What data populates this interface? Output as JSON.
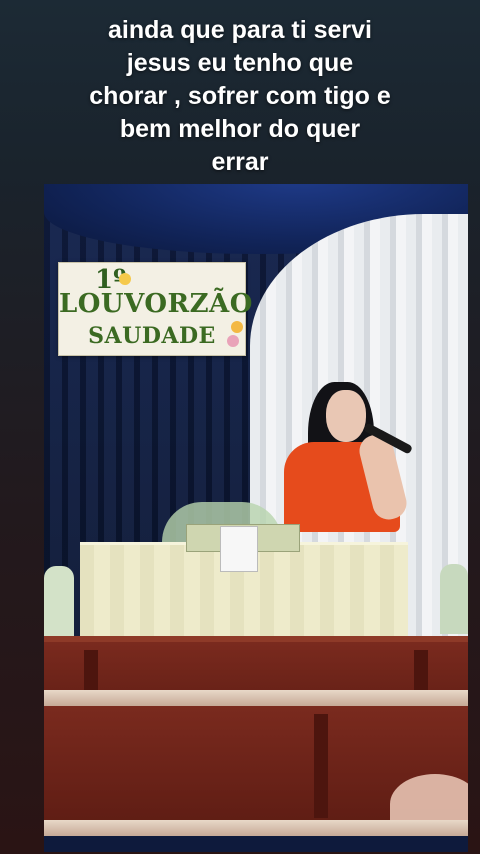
{
  "caption": {
    "lines": [
      "ainda que para ti servi",
      "jesus eu tenho que",
      "chorar , sofrer com tigo e",
      "bem melhor do quer",
      "errar"
    ]
  },
  "banner": {
    "number": "1º",
    "line1": "LOUVORZÃO",
    "line2": "SAUDADE"
  },
  "colors": {
    "curtain": "#0c1835",
    "singer_shirt": "#e64b1c",
    "pews": "#5f1d14",
    "banner_text": "#3b6a22"
  }
}
